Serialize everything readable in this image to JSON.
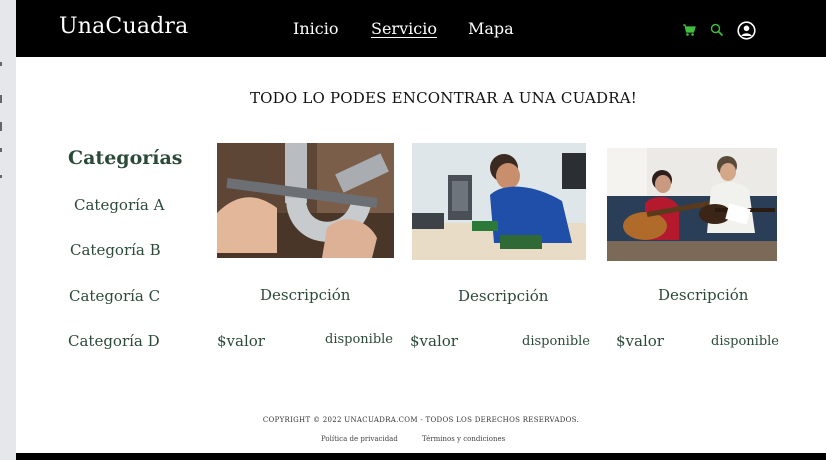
{
  "header": {
    "brand": "UnaCuadra",
    "nav": [
      "Inicio",
      "Servicio",
      "Mapa"
    ],
    "active_nav": "Servicio",
    "icon_color": "#3fbf3f",
    "icons": [
      "cart-icon",
      "search-icon",
      "user-icon"
    ]
  },
  "headline": "TODO LO PODES ENCONTRAR A UNA CUADRA!",
  "categories": {
    "title": "Categorías",
    "items": [
      "Categoría A",
      "Categoría B",
      "Categoría C",
      "Categoría D"
    ]
  },
  "cards": [
    {
      "image": "plumbing-wrench-photo",
      "description": "Descripción",
      "price": "$valor",
      "availability": "disponible"
    },
    {
      "image": "computer-repair-photo",
      "description": "Descripción",
      "price": "$valor",
      "availability": "disponible"
    },
    {
      "image": "guitar-lesson-photo",
      "description": "Descripción",
      "price": "$valor",
      "availability": "disponible"
    }
  ],
  "footer": {
    "copyright": "COPYRIGHT © 2022 UNACUADRA.COM - TODOS LOS DERECHOS RESERVADOS.",
    "privacy": "Política de privacidad",
    "terms": "Términos y condiciones"
  },
  "colors": {
    "text_green": "#2c4a3a",
    "navbar": "#000000"
  }
}
